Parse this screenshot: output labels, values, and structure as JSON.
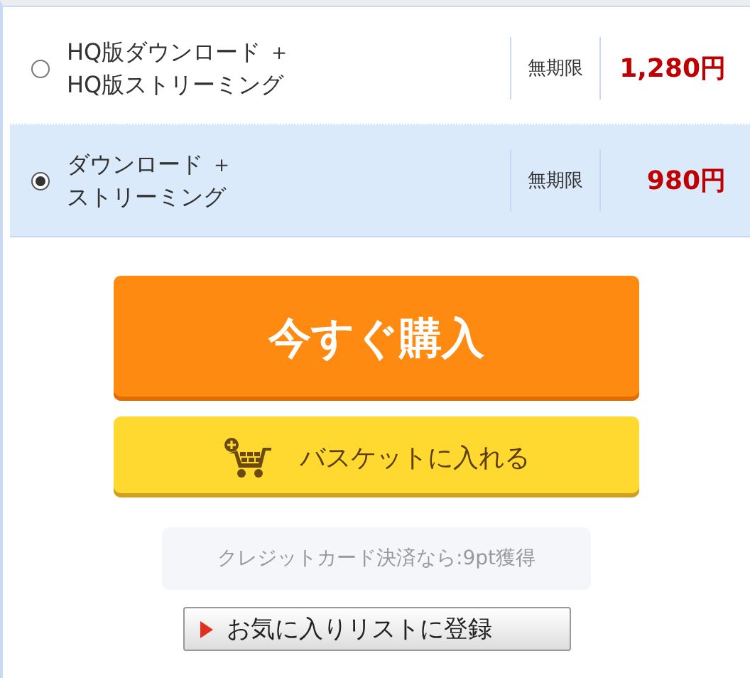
{
  "options": [
    {
      "label_lines": [
        "HQ版ダウンロード ＋",
        "HQ版ストリーミング"
      ],
      "period": "無期限",
      "price": "1,280円",
      "selected": false
    },
    {
      "label_lines": [
        "ダウンロード ＋",
        "ストリーミング"
      ],
      "period": "無期限",
      "price": "980円",
      "selected": true
    }
  ],
  "buy_button": "今すぐ購入",
  "basket_button": "バスケットに入れる",
  "points_note": "クレジットカード決済なら:9pt獲得",
  "favorite_button": "お気に入りリストに登録"
}
